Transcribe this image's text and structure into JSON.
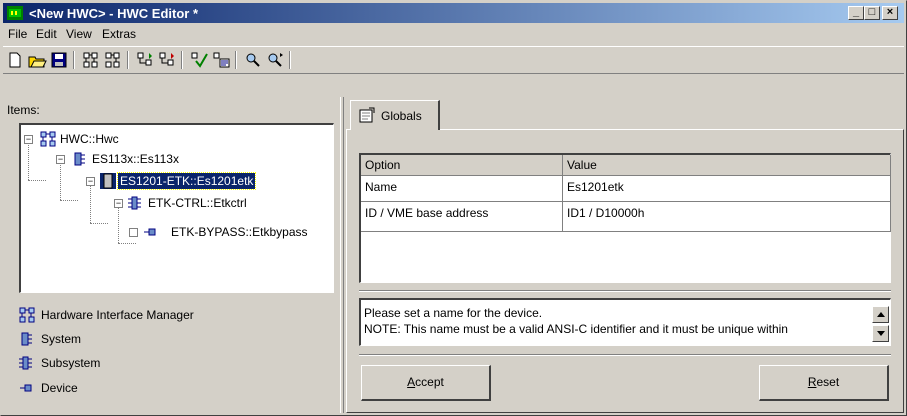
{
  "window": {
    "title": "<New HWC> - HWC Editor  *"
  },
  "menu": [
    "File",
    "Edit",
    "View",
    "Extras"
  ],
  "toolbar": [
    "new-icon",
    "open-icon",
    "save-icon",
    "add-hw-icon",
    "remove-hw-icon",
    "import-icon",
    "export-icon",
    "check-icon",
    "compile-icon",
    "find-icon",
    "find-next-icon"
  ],
  "items_label": "Items:",
  "tree": [
    {
      "label": "HWC::Hwc",
      "level": 0,
      "icon": "hardware-interface-manager-icon",
      "expander": "−",
      "selected": false
    },
    {
      "label": "ES113x::Es113x",
      "level": 1,
      "icon": "system-icon",
      "expander": "−",
      "selected": false
    },
    {
      "label": "ES1201-ETK::Es1201etk",
      "level": 2,
      "icon": "module-icon",
      "expander": "−",
      "selected": true
    },
    {
      "label": "ETK-CTRL::Etkctrl",
      "level": 3,
      "icon": "subsystem-icon",
      "expander": "−",
      "selected": false
    },
    {
      "label": "ETK-BYPASS::Etkbypass",
      "level": 4,
      "icon": "device-icon",
      "expander": "",
      "selected": false
    }
  ],
  "legend": [
    {
      "icon": "hardware-interface-manager-icon",
      "label": "Hardware Interface Manager"
    },
    {
      "icon": "system-icon",
      "label": "System"
    },
    {
      "icon": "subsystem-icon",
      "label": "Subsystem"
    },
    {
      "icon": "device-icon",
      "label": "Device"
    }
  ],
  "tab": {
    "label": "Globals"
  },
  "grid": {
    "columns": [
      "Option",
      "Value"
    ],
    "rows": [
      [
        "Name",
        "Es1201etk"
      ],
      [
        "ID / VME base address",
        "ID1 / D10000h"
      ]
    ]
  },
  "help": {
    "line1": "Please set a name for the device.",
    "line2": "NOTE: This name must be a valid ANSI-C identifier and it must be unique within"
  },
  "buttons": {
    "accept_mnemonic": "A",
    "accept_rest": "ccept",
    "reset_mnemonic": "R",
    "reset_rest": "eset"
  },
  "colors": {
    "titlebar_start": "#0a246a",
    "titlebar_end": "#a6caf0",
    "selection": "#0a246a",
    "face": "#d4d0c8"
  }
}
